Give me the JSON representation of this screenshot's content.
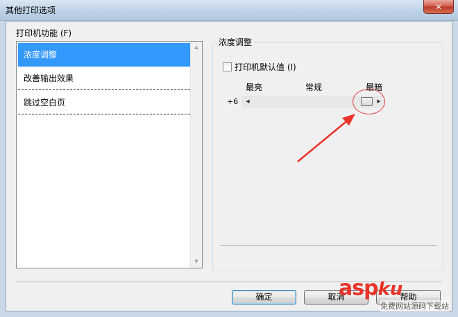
{
  "window": {
    "title": "其他打印选项",
    "close_glyph": "✕"
  },
  "features": {
    "label": "打印机功能 (F)",
    "items": [
      {
        "label": "浓度调整",
        "selected": true
      },
      {
        "label": "改善输出效果",
        "selected": false
      },
      {
        "label": "跳过空白页",
        "selected": false
      }
    ]
  },
  "density": {
    "group_title": "浓度调整",
    "checkbox_label": "打印机默认值 (I)",
    "checkbox_checked": false,
    "scale_labels": [
      "最亮",
      "常规",
      "最暗"
    ],
    "value_label": "+6",
    "slider_level": 1.0
  },
  "buttons": {
    "ok": "确定",
    "cancel": "取消",
    "help": "帮助"
  },
  "watermark": {
    "brand_main": "asp",
    "brand_ku": "ku",
    "sub_text": "免费网站源码下载站"
  },
  "colors": {
    "selection": "#3399ff",
    "highlight": "#e24a4a"
  },
  "icons": {
    "scroll_up": "scroll-up-arrow-icon",
    "scroll_down": "scroll-down-arrow-icon",
    "slider_left": "slider-left-arrow-icon",
    "slider_right": "slider-right-arrow-icon",
    "annotation": "red-arrow-annotation-icon"
  }
}
